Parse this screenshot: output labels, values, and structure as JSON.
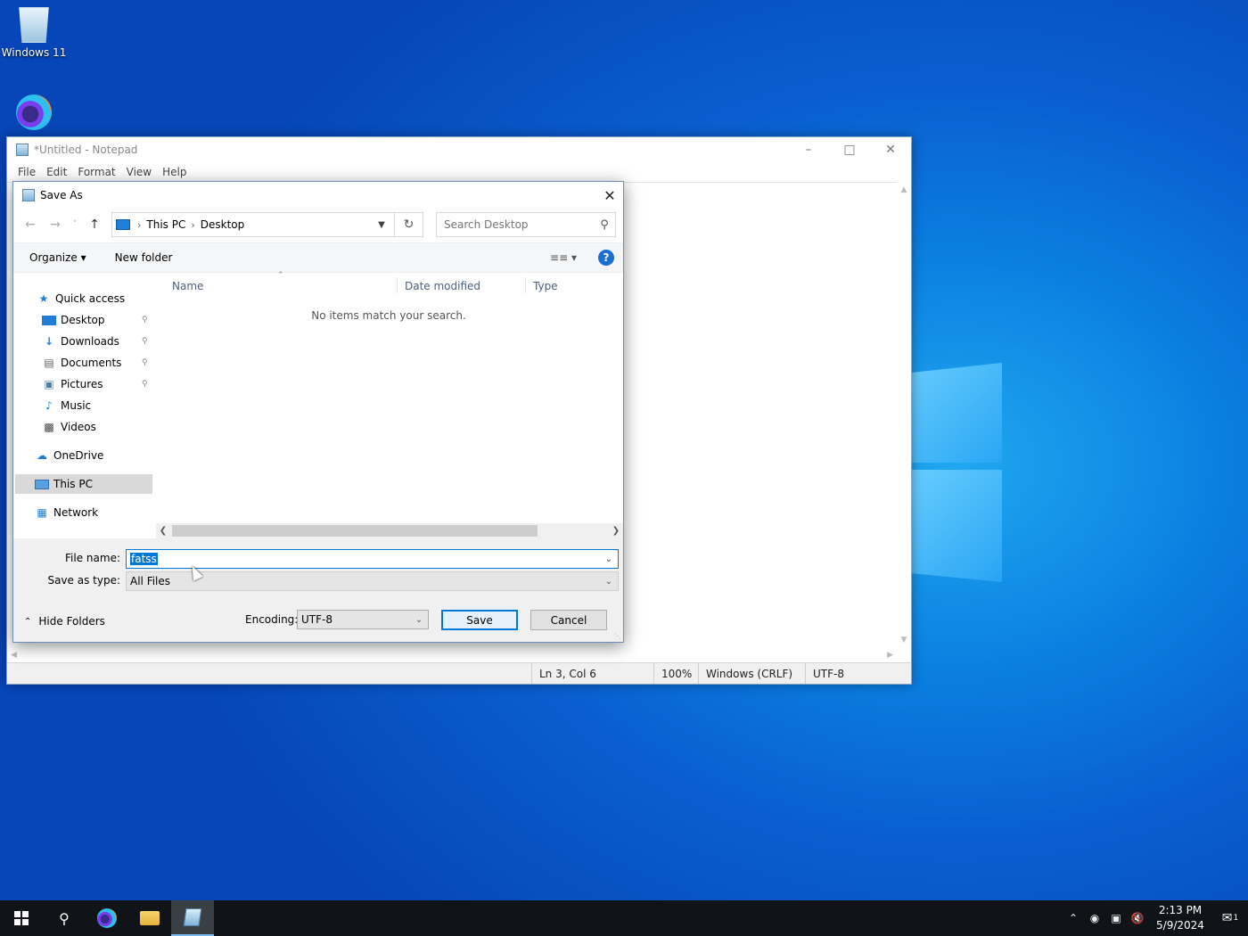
{
  "desktop": {
    "icons": [
      {
        "label": "Windows 11"
      }
    ]
  },
  "notepad": {
    "title": "*Untitled - Notepad",
    "menu": [
      "File",
      "Edit",
      "Format",
      "View",
      "Help"
    ],
    "status": {
      "position": "Ln 3, Col 6",
      "zoom": "100%",
      "line_ending": "Windows (CRLF)",
      "encoding": "UTF-8"
    }
  },
  "dialog": {
    "title": "Save As",
    "address": {
      "crumbs": [
        "This PC",
        "Desktop"
      ]
    },
    "search_placeholder": "Search Desktop",
    "toolbar": {
      "organize": "Organize",
      "new_folder": "New folder"
    },
    "nav": {
      "quick_access": "Quick access",
      "items": [
        {
          "label": "Desktop",
          "pinned": true
        },
        {
          "label": "Downloads",
          "pinned": true
        },
        {
          "label": "Documents",
          "pinned": true
        },
        {
          "label": "Pictures",
          "pinned": true
        },
        {
          "label": "Music",
          "pinned": false
        },
        {
          "label": "Videos",
          "pinned": false
        }
      ],
      "onedrive": "OneDrive",
      "this_pc": "This PC",
      "network": "Network"
    },
    "columns": [
      "Name",
      "Date modified",
      "Type"
    ],
    "empty_message": "No items match your search.",
    "file_name_label": "File name:",
    "file_name_value": "fatss",
    "save_as_type_label": "Save as type:",
    "save_as_type_value": "All Files",
    "hide_folders": "Hide Folders",
    "encoding_label": "Encoding:",
    "encoding_value": "UTF-8",
    "save_button": "Save",
    "cancel_button": "Cancel"
  },
  "taskbar": {
    "time": "2:13 PM",
    "date": "5/9/2024",
    "notification_count": "1"
  }
}
